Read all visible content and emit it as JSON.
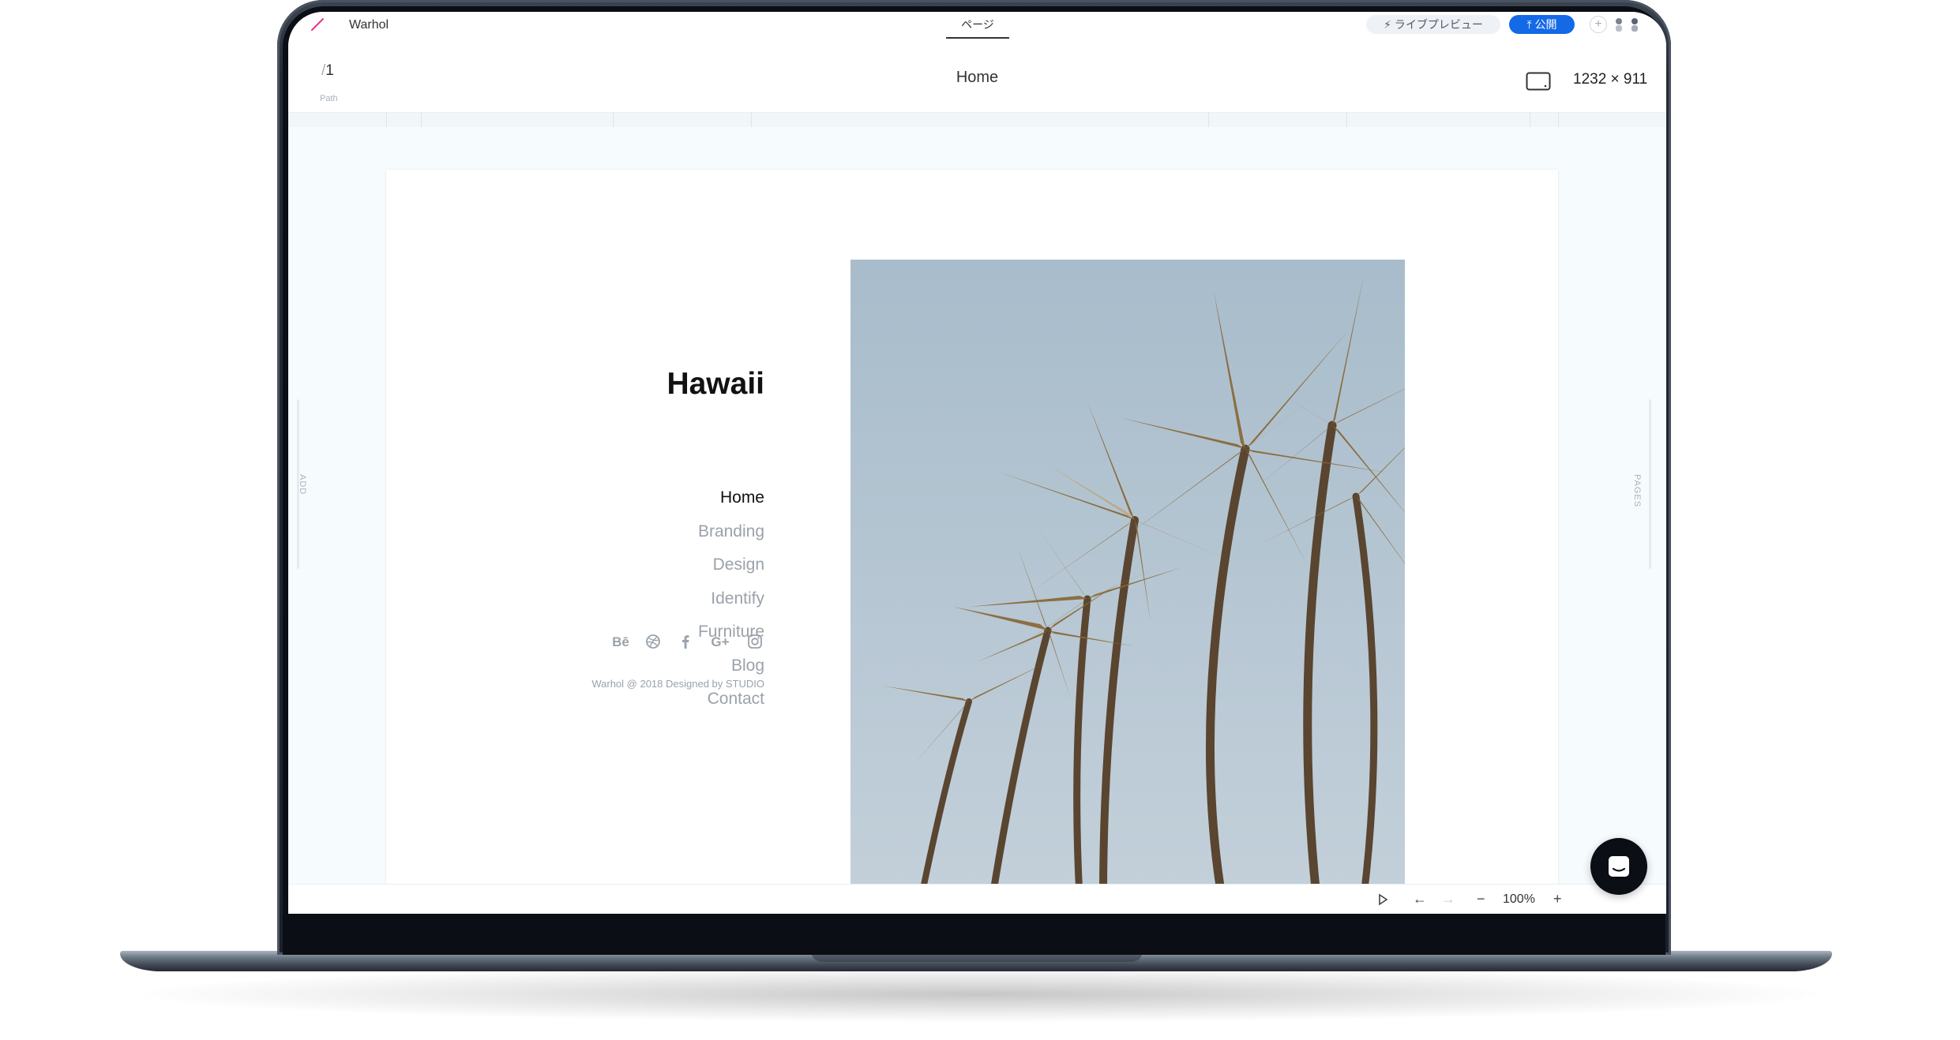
{
  "app": {
    "name": "Warhol",
    "center_tab": "ページ",
    "preview_label": "ライブプレビュー",
    "publish_label": "公開"
  },
  "toolbar": {
    "path_number": "1",
    "path_label": "Path",
    "page_name": "Home",
    "dimensions": "1232 × 911"
  },
  "side": {
    "left_label": "ADD",
    "right_label": "PAGES"
  },
  "site": {
    "title": "Hawaii",
    "nav": [
      {
        "label": "Home",
        "active": true
      },
      {
        "label": "Branding",
        "active": false
      },
      {
        "label": "Design",
        "active": false
      },
      {
        "label": "Identify",
        "active": false
      },
      {
        "label": "Furniture",
        "active": false
      },
      {
        "label": "Blog",
        "active": false
      },
      {
        "label": "Contact",
        "active": false
      }
    ],
    "social_icons": [
      "behance-icon",
      "dribbble-icon",
      "facebook-icon",
      "google-plus-icon",
      "instagram-icon"
    ],
    "footer": "Warhol @ 2018 Designed by STUDIO"
  },
  "bottom": {
    "zoom": "100%"
  },
  "colors": {
    "accent": "#1469e6",
    "muted_text": "#9aa2aa",
    "canvas_bg": "#f6fbfd",
    "device_frame": "#1b2029"
  }
}
